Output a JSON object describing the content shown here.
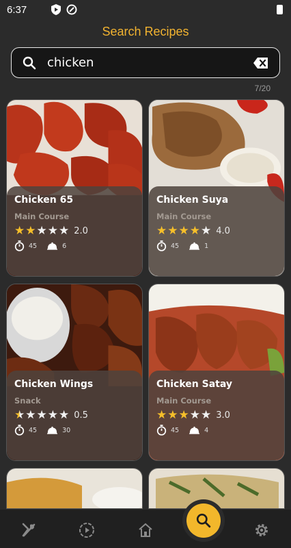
{
  "status_bar": {
    "time": "6:37"
  },
  "header": {
    "title": "Search Recipes"
  },
  "search": {
    "value": "chicken"
  },
  "results": {
    "count_label": "7/20"
  },
  "colors": {
    "accent": "#f2b330",
    "star_filled": "#f6bf2a",
    "star_empty": "#f2f2f2"
  },
  "recipes": [
    {
      "name": "Chicken 65",
      "category": "Main Course",
      "rating": "2.0",
      "rating_value": 2.0,
      "time": "45",
      "servings": "6"
    },
    {
      "name": "Chicken Suya",
      "category": "Main Course",
      "rating": "4.0",
      "rating_value": 4.0,
      "time": "45",
      "servings": "1"
    },
    {
      "name": "Chicken Wings",
      "category": "Snack",
      "rating": "0.5",
      "rating_value": 0.5,
      "time": "45",
      "servings": "30"
    },
    {
      "name": "Chicken Satay",
      "category": "Main Course",
      "rating": "3.0",
      "rating_value": 3.0,
      "time": "45",
      "servings": "4"
    }
  ],
  "nav": {
    "items": [
      {
        "icon": "utensils-icon"
      },
      {
        "icon": "play-circle-icon"
      },
      {
        "icon": "home-icon"
      },
      {
        "icon": "search-icon",
        "active": true
      },
      {
        "icon": "gear-icon"
      }
    ]
  }
}
